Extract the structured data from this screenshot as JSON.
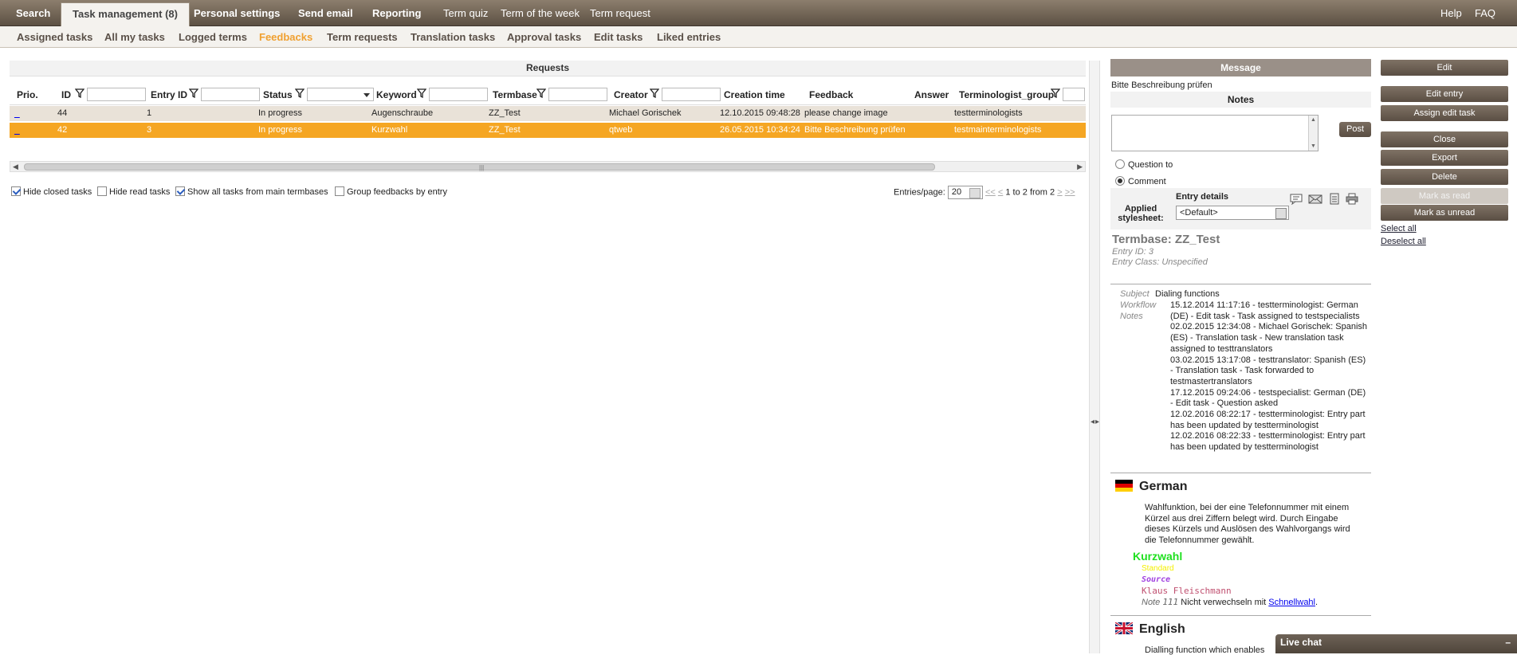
{
  "topnav": {
    "search": "Search",
    "task_management": "Task management (8)",
    "personal_settings": "Personal settings",
    "send_email": "Send email",
    "reporting": "Reporting",
    "term_quiz": "Term quiz",
    "term_of_week": "Term of the week",
    "term_request": "Term request",
    "help": "Help",
    "faq": "FAQ"
  },
  "subnav": {
    "assigned": "Assigned tasks",
    "all_my": "All my tasks",
    "logged": "Logged terms",
    "feedbacks": "Feedbacks",
    "term_requests": "Term requests",
    "translation": "Translation tasks",
    "approval": "Approval tasks",
    "edit": "Edit tasks",
    "liked": "Liked entries"
  },
  "requests": {
    "title": "Requests",
    "columns": {
      "prio": "Prio.",
      "id": "ID",
      "entry_id": "Entry ID",
      "status": "Status",
      "keyword": "Keyword",
      "termbase": "Termbase",
      "creator": "Creator",
      "creation_time": "Creation time",
      "feedback": "Feedback",
      "answer": "Answer",
      "group": "Terminologist_group"
    },
    "rows": [
      {
        "prio": "_",
        "id": "44",
        "entry_id": "1",
        "status": "In progress",
        "keyword": "Augenschraube",
        "termbase": "ZZ_Test",
        "creator": "Michael Gorischek",
        "creation_time": "12.10.2015 09:48:28",
        "feedback": "please change image",
        "answer": "",
        "group": "testterminologists"
      },
      {
        "prio": "_",
        "id": "42",
        "entry_id": "3",
        "status": "In progress",
        "keyword": "Kurzwahl",
        "termbase": "ZZ_Test",
        "creator": "qtweb",
        "creation_time": "26.05.2015 10:34:24",
        "feedback": "Bitte Beschreibung prüfen",
        "answer": "",
        "group": "testmainterminologists"
      }
    ],
    "options": {
      "hide_closed": "Hide closed tasks",
      "hide_read": "Hide read tasks",
      "show_all": "Show all tasks from main termbases",
      "group_feedbacks": "Group feedbacks by entry"
    },
    "paging": {
      "label": "Entries/page:",
      "per_page": "20",
      "first": "<<",
      "prev": "<",
      "range": "1 to 2 from 2",
      "next": ">",
      "last": ">>"
    }
  },
  "message": {
    "header": "Message",
    "text": "Bitte Beschreibung prüfen",
    "notes_header": "Notes",
    "post": "Post",
    "question_to": "Question to",
    "comment": "Comment",
    "entry_details": "Entry details",
    "applied_stylesheet": "Applied stylesheet:",
    "stylesheet_value": "<Default>"
  },
  "entry": {
    "termbase": "Termbase: ZZ_Test",
    "entry_id": "Entry ID: 3",
    "entry_class": "Entry Class: Unspecified",
    "subject_label": "Subject",
    "subject_value": "Dialing functions",
    "workflow_label": "Workflow",
    "notes_label": "Notes",
    "workflow": [
      "15.12.2014 11:17:16 - testterminologist: German (DE) - Edit task - Task assigned to testspecialists",
      "02.02.2015 12:34:08 - Michael Gorischek: Spanish (ES) - Translation task - New translation task assigned to testtranslators",
      "03.02.2015 13:17:08 - testtranslator: Spanish (ES) - Translation task - Task forwarded to testmastertranslators",
      "17.12.2015 09:24:06 - testspecialist: German (DE) - Edit task - Question asked",
      "12.02.2016 08:22:17 - testterminologist: Entry part has been updated by testterminologist",
      "12.02.2016 08:22:33 - testterminologist: Entry part has been updated by testterminologist"
    ],
    "german": {
      "language": "German",
      "definition": "Wahlfunktion, bei der eine Telefonnummer mit einem Kürzel aus drei Ziffern belegt wird. Durch Eingabe dieses Kürzels und Auslösen des Wahlvorgangs wird die Telefonnummer gewählt.",
      "term": "Kurzwahl",
      "status": "Standard",
      "source_label": "Source",
      "author": "Klaus Fleischmann",
      "note_label": "Note",
      "note_code": "111",
      "note_text": "Nicht verwechseln mit",
      "note_link": "Schnellwahl",
      "note_end": "."
    },
    "english": {
      "language": "English",
      "definition": "Dialling function which enables"
    }
  },
  "actions": {
    "edit": "Edit",
    "edit_entry": "Edit entry",
    "assign_edit_task": "Assign edit task",
    "close": "Close",
    "export": "Export",
    "delete": "Delete",
    "mark_read": "Mark as read",
    "mark_unread": "Mark as unread",
    "select_all": "Select all",
    "deselect_all": "Deselect all"
  },
  "livechat": {
    "label": "Live chat",
    "minimize": "–"
  },
  "colors": {
    "nav": "#6e6357",
    "accent": "#f5a623",
    "active_tab": "#f0a030",
    "term": "#1fe01f"
  }
}
